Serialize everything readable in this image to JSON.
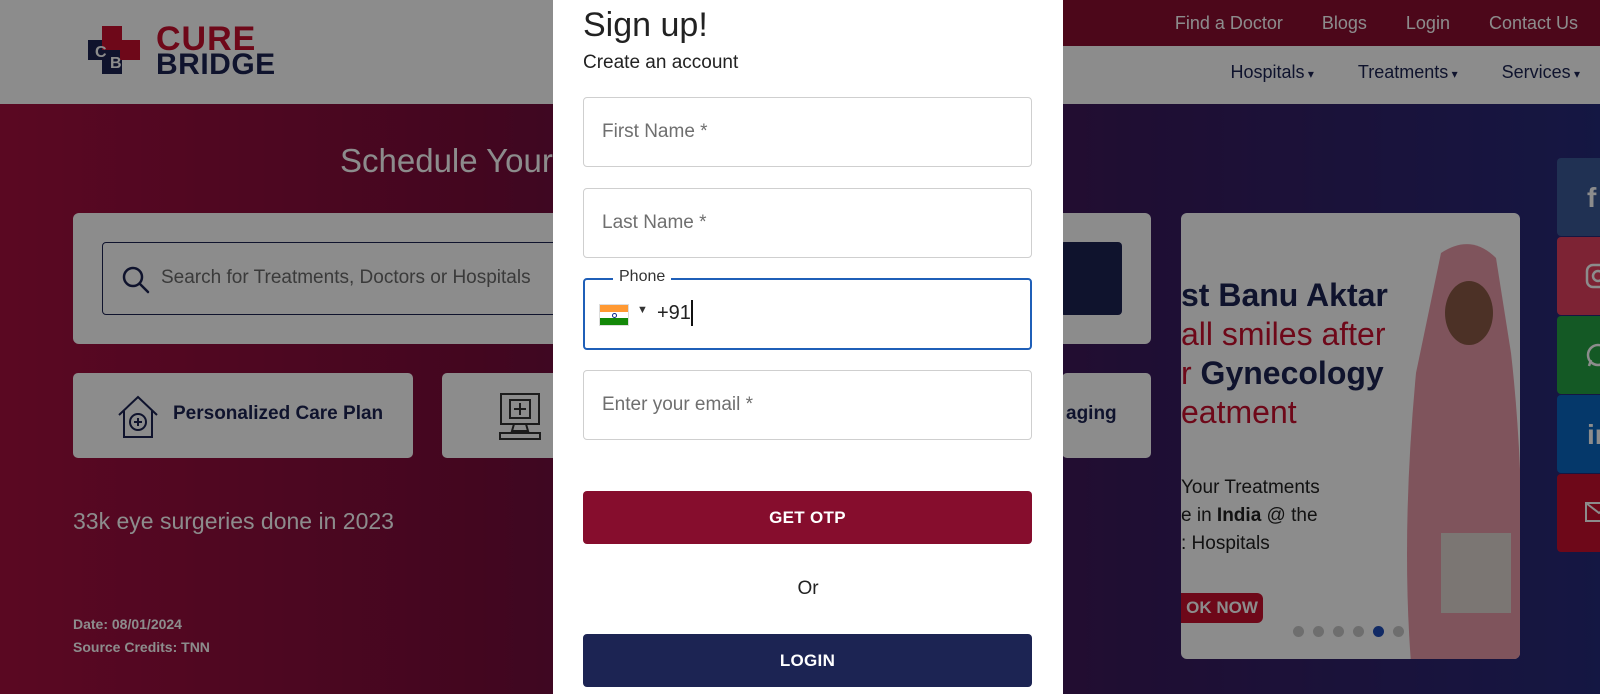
{
  "header": {
    "logo_line1": "CURE",
    "logo_line2": "BRIDGE",
    "top_links": [
      "Find a Doctor",
      "Blogs",
      "Login",
      "Contact Us"
    ],
    "nav": [
      "Hospitals",
      "Treatments",
      "Services"
    ]
  },
  "hero": {
    "title": "Schedule Your",
    "search_placeholder": "Search for Treatments, Doctors or Hospitals",
    "features": [
      "Personalized Care Plan",
      "aging"
    ],
    "stat": "33k eye surgeries done in 2023",
    "date": "Date: 08/01/2024",
    "credits": "Source Credits: TNN"
  },
  "carousel": {
    "line1": "st Banu Aktar",
    "line2": "all smiles after",
    "line3_prefix": "r",
    "line3_bold": "Gynecology",
    "line4": "eatment",
    "sub1": "Your Treatments",
    "sub2_prefix": "e in",
    "sub2_bold": "India",
    "sub2_suffix": "@ the",
    "sub3": ": Hospitals",
    "book": "OK NOW",
    "active_slide": 5,
    "total_slides": 6
  },
  "social": [
    "facebook-icon",
    "instagram-icon",
    "whatsapp-icon",
    "linkedin-icon",
    "mail-icon"
  ],
  "modal": {
    "title": "Sign up!",
    "subtitle": "Create an account",
    "first_name_placeholder": "First Name *",
    "last_name_placeholder": "Last Name *",
    "phone_label": "Phone",
    "phone_value": "+91",
    "email_placeholder": "Enter your email *",
    "otp_button": "GET OTP",
    "or_text": "Or",
    "login_button": "LOGIN"
  },
  "colors": {
    "brand_red": "#860d2d",
    "brand_navy": "#1c2453",
    "focus_blue": "#1f5fb8"
  }
}
